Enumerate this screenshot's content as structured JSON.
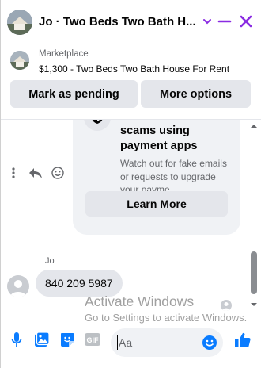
{
  "header": {
    "title": "Jo · Two Beds Two Bath H...",
    "accent_color": "#8a2be2"
  },
  "marketplace": {
    "label": "Marketplace",
    "item": "$1,300 - Two Beds Two Bath House For Rent",
    "mark_pending_label": "Mark as pending",
    "more_options_label": "More options"
  },
  "safety_card": {
    "title": "Beware of common scams using payment apps",
    "body": "Watch out for fake emails or requests to upgrade your payme...",
    "button_label": "Learn More",
    "icon": "shield-icon"
  },
  "message": {
    "sender": "Jo",
    "text": "840 209 5987"
  },
  "watermark": {
    "title": "Activate Windows",
    "subtitle": "Go to Settings to activate Windows."
  },
  "composer": {
    "placeholder": "Aa",
    "brand_color": "#0a7cff"
  }
}
